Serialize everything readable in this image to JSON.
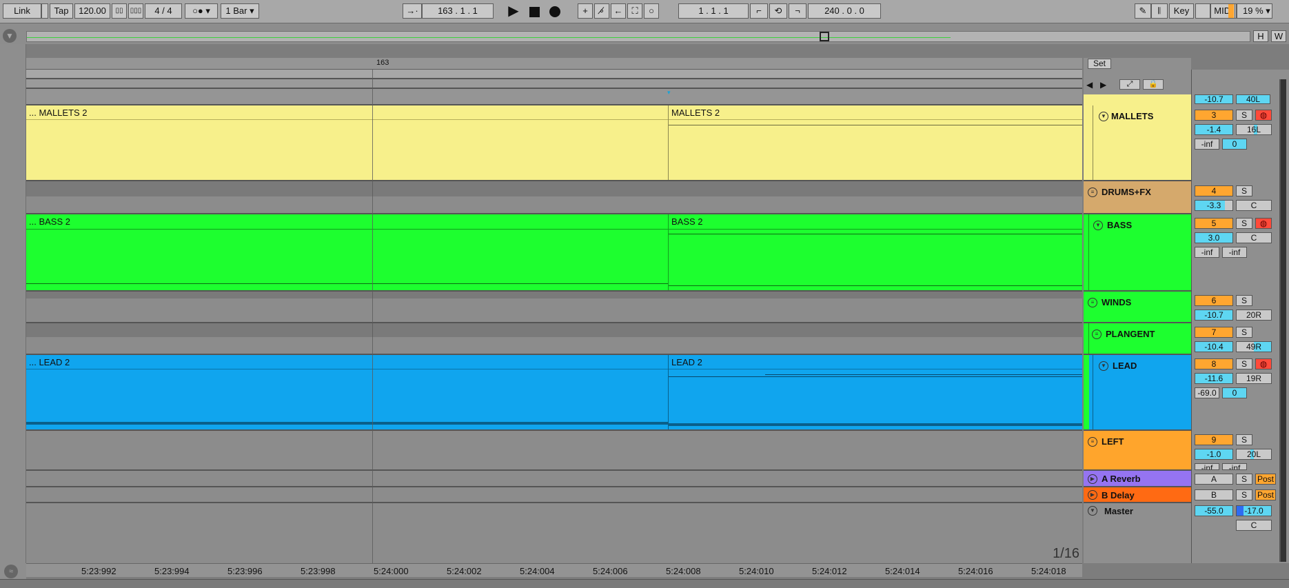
{
  "transport": {
    "link": "Link",
    "tap": "Tap",
    "tempo": "120.00",
    "time_signature": "4 / 4",
    "quantize": "1 Bar",
    "arrangement_position": "163 .   1 .   1",
    "loop_start": "1 .   1 .   1",
    "loop_length": "240 .   0 .   0",
    "key": "Key",
    "midi": "MIDI",
    "cpu": "19 %"
  },
  "overview": {
    "h_label": "H",
    "w_label": "W"
  },
  "ruler": {
    "bar_label": "163"
  },
  "view_buttons": {
    "set_label": "Set"
  },
  "clips": {
    "mallets_left": "... MALLETS 2",
    "mallets_right": "MALLETS 2",
    "bass_left": "... BASS 2",
    "bass_right": "BASS 2",
    "lead_left": "... LEAD 2",
    "lead_right": "LEAD 2"
  },
  "tracks": [
    {
      "name": "MALLETS",
      "number": "3",
      "solo": "S",
      "volume": "-1.4",
      "pan": "16L",
      "extra1": "-inf",
      "extra2": "0",
      "color": "#f7f08b"
    },
    {
      "name": "DRUMS+FX",
      "number": "4",
      "solo": "S",
      "volume": "-3.3",
      "pan": "C",
      "color": "#d5a96c"
    },
    {
      "name": "BASS",
      "number": "5",
      "solo": "S",
      "volume": "3.0",
      "pan": "C",
      "extra1": "-inf",
      "extra2": "-inf",
      "color": "#1dff2f"
    },
    {
      "name": "WINDS",
      "number": "6",
      "solo": "S",
      "volume": "-10.7",
      "pan": "20R",
      "color": "#1dff2f"
    },
    {
      "name": "PLANGENT",
      "number": "7",
      "solo": "S",
      "volume": "-10.4",
      "pan": "49R",
      "color": "#1dff2f"
    },
    {
      "name": "LEAD",
      "number": "8",
      "solo": "S",
      "volume": "-11.6",
      "pan": "19R",
      "extra1": "-69.0",
      "extra2": "0",
      "color": "#10a5ee"
    },
    {
      "name": "LEFT",
      "number": "9",
      "solo": "S",
      "volume": "-1.0",
      "pan": "20L",
      "extra1": "-inf",
      "extra2": "-inf",
      "color": "#ffa52c"
    },
    {
      "name": "A Reverb",
      "number": "A",
      "solo": "S",
      "post": "Post",
      "color": "#9574f1"
    },
    {
      "name": "B Delay",
      "number": "B",
      "solo": "S",
      "post": "Post",
      "color": "#ff6a13"
    },
    {
      "name": "Master",
      "volume": "-55.0",
      "pan": "-17.0",
      "pan2": "C",
      "color": "#8f8f8f"
    }
  ],
  "top_partial": {
    "volume": "-10.7",
    "pan": "40L"
  },
  "grid_label": "1/16",
  "time_labels": [
    "5:23:992",
    "5:23:994",
    "5:23:996",
    "5:23:998",
    "5:24:000",
    "5:24:002",
    "5:24:004",
    "5:24:006",
    "5:24:008",
    "5:24:010",
    "5:24:012",
    "5:24:014",
    "5:24:016",
    "5:24:018"
  ],
  "colors": {
    "mallets": "#f7f08b",
    "drums": "#d5a96c",
    "green": "#1dff2f",
    "lead": "#10a5ee",
    "left": "#ffa52c",
    "reverb": "#9574f1",
    "delay": "#ff6a13",
    "accent_orange": "#ffa630",
    "cyan": "#5ed6f2"
  },
  "icons": [
    "fold-triangle-icon",
    "play-icon",
    "stop-icon",
    "record-icon",
    "pencil-icon",
    "piano-icon",
    "lock-icon",
    "arrow-left-icon",
    "arrow-right-icon"
  ]
}
